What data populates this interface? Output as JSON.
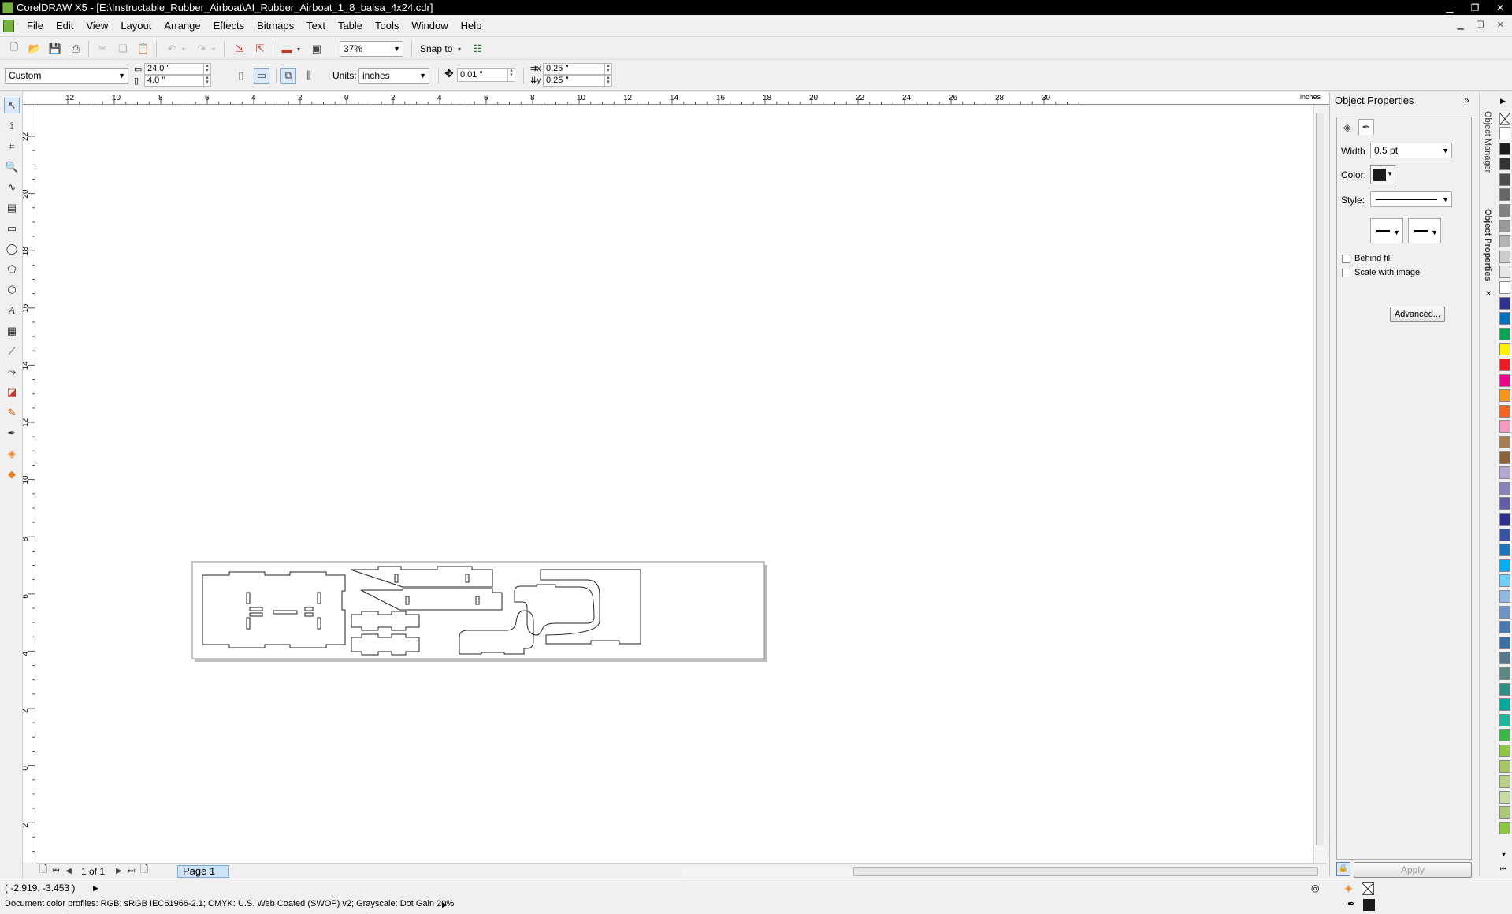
{
  "window": {
    "title": "CorelDRAW X5 - [E:\\Instructable_Rubber_Airboat\\AI_Rubber_Airboat_1_8_balsa_4x24.cdr]",
    "minimize_glyph": "▁",
    "maximize_glyph": "❐",
    "close_glyph": "✕"
  },
  "menu": [
    {
      "label": "File"
    },
    {
      "label": "Edit"
    },
    {
      "label": "View"
    },
    {
      "label": "Layout"
    },
    {
      "label": "Arrange"
    },
    {
      "label": "Effects"
    },
    {
      "label": "Bitmaps"
    },
    {
      "label": "Text"
    },
    {
      "label": "Table"
    },
    {
      "label": "Tools"
    },
    {
      "label": "Window"
    },
    {
      "label": "Help"
    }
  ],
  "toolbar": {
    "zoom_value": "37%",
    "snap_label": "Snap to"
  },
  "property_bar": {
    "page_preset": "Custom",
    "page_width": "24.0 \"",
    "page_height": "4.0 \"",
    "units_label": "Units:",
    "units_value": "inches",
    "nudge_value": "0.01 \"",
    "dup_x": "0.25 \"",
    "dup_y": "0.25 \""
  },
  "ruler": {
    "unit": "inches",
    "h_labels": [
      "12",
      "10",
      "8",
      "6",
      "4",
      "2",
      "0",
      "2",
      "4",
      "6",
      "8",
      "10",
      "12",
      "14",
      "16",
      "18",
      "20",
      "22",
      "24",
      "26",
      "28",
      "30"
    ],
    "v_labels": [
      "22",
      "20",
      "18",
      "16",
      "14",
      "12",
      "10",
      "8",
      "6",
      "4",
      "2",
      "0",
      "2"
    ]
  },
  "navigator": {
    "page_count": "1 of 1",
    "page_tab": "Page 1"
  },
  "status": {
    "cursor_coords": "( -2.919, -3.453 )",
    "color_profiles": "Document color profiles: RGB: sRGB IEC61966-2.1; CMYK: U.S. Web Coated (SWOP) v2; Grayscale: Dot Gain 20%"
  },
  "docker": {
    "title": "Object Properties",
    "width_label": "Width",
    "width_value": "0.5 pt",
    "color_label": "Color:",
    "style_label": "Style:",
    "behind_fill_label": "Behind fill",
    "scale_with_image_label": "Scale with image",
    "advanced_button": "Advanced...",
    "apply_button": "Apply",
    "outline_color": "#1a1a1a"
  },
  "side_tabs": {
    "object_manager": "Object Manager",
    "object_properties": "Object Properties"
  },
  "palette": [
    "#ffffff",
    "#1a1a1a",
    "#333333",
    "#4d4d4d",
    "#666666",
    "#808080",
    "#999999",
    "#b3b3b3",
    "#cccccc",
    "#e6e6e6",
    "#ffffff",
    "#2e3192",
    "#0071bc",
    "#00a651",
    "#fff200",
    "#ed1c24",
    "#ec008c",
    "#f7941d",
    "#f26522",
    "#f49ac1",
    "#a67c52",
    "#8c6239",
    "#b4a7d6",
    "#8781bd",
    "#605ca8",
    "#2e3192",
    "#3953a4",
    "#1b75bb",
    "#00aeef",
    "#6dcff6",
    "#8fb8de",
    "#6f93c4",
    "#4b78b0",
    "#3f6ea0",
    "#59788e",
    "#5b8a86",
    "#2f8f83",
    "#00a99d",
    "#1fb598",
    "#39b54a",
    "#8dc63f",
    "#a7c765",
    "#b9d282",
    "#c7dca3",
    "#aac87a",
    "#8dc63f"
  ]
}
